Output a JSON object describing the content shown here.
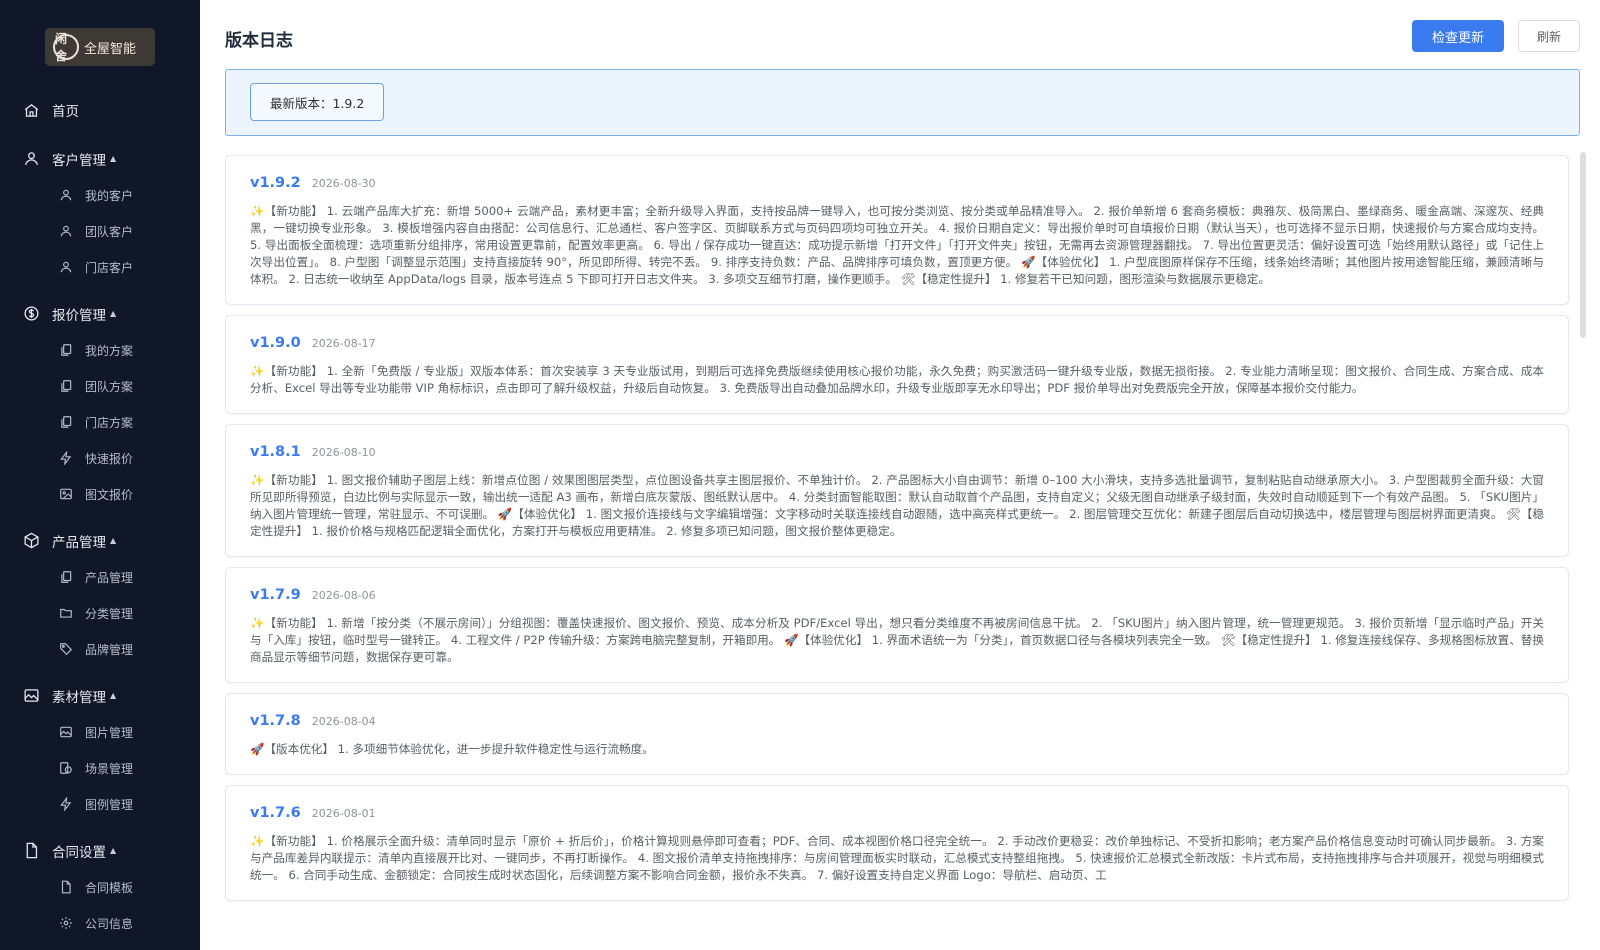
{
  "brand": {
    "logo_mark": "闲舍",
    "logo_text": "全屋智能"
  },
  "sidebar": {
    "home": "首页",
    "groups": [
      {
        "label": "客户管理",
        "items": [
          "我的客户",
          "团队客户",
          "门店客户"
        ]
      },
      {
        "label": "报价管理",
        "items": [
          "我的方案",
          "团队方案",
          "门店方案",
          "快速报价",
          "图文报价"
        ]
      },
      {
        "label": "产品管理",
        "items": [
          "产品管理",
          "分类管理",
          "品牌管理"
        ]
      },
      {
        "label": "素材管理",
        "items": [
          "图片管理",
          "场景管理",
          "图例管理"
        ]
      },
      {
        "label": "合同设置",
        "items": [
          "合同模板",
          "公司信息"
        ]
      }
    ],
    "caret": "▲"
  },
  "header": {
    "title": "版本日志",
    "check_update": "检查更新",
    "refresh": "刷新"
  },
  "current_version": "最新版本：1.9.2",
  "logs": [
    {
      "version": "v1.9.2",
      "date": "2026-08-30",
      "text": "✨【新功能】 1. 云端产品库大扩充：新增 5000+ 云端产品，素材更丰富；全新升级导入界面，支持按品牌一键导入，也可按分类浏览、按分类或单品精准导入。 2. 报价单新增 6 套商务模板：典雅灰、极简黑白、墨绿商务、暖金高端、深邃灰、经典黑，一键切换专业形象。 3. 模板增强内容自由搭配：公司信息行、汇总通栏、客户签字区、页脚联系方式与页码四项均可独立开关。 4. 报价日期自定义：导出报价单时可自填报价日期（默认当天），也可选择不显示日期，快速报价与方案合成均支持。 5. 导出面板全面梳理：选项重新分组排序，常用设置更靠前，配置效率更高。 6. 导出 / 保存成功一键直达：成功提示新增「打开文件」「打开文件夹」按钮，无需再去资源管理器翻找。 7. 导出位置更灵活：偏好设置可选「始终用默认路径」或「记住上次导出位置」。 8. 户型图「调整显示范围」支持直接旋转 90°，所见即所得、转完不丢。 9. 排序支持负数：产品、品牌排序可填负数，置顶更方便。 🚀【体验优化】 1. 户型底图原样保存不压缩，线条始终清晰；其他图片按用途智能压缩，兼顾清晰与体积。 2. 日志统一收纳至 AppData/logs 目录，版本号连点 5 下即可打开日志文件夹。 3. 多项交互细节打磨，操作更顺手。 🛠【稳定性提升】 1. 修复若干已知问题，图形渲染与数据展示更稳定。"
    },
    {
      "version": "v1.9.0",
      "date": "2026-08-17",
      "text": "✨【新功能】 1. 全新「免费版 / 专业版」双版本体系：首次安装享 3 天专业版试用，到期后可选择免费版继续使用核心报价功能，永久免费；购买激活码一键升级专业版，数据无损衔接。 2. 专业能力清晰呈现：图文报价、合同生成、方案合成、成本分析、Excel 导出等专业功能带 VIP 角标标识，点击即可了解升级权益，升级后自动恢复。 3. 免费版导出自动叠加品牌水印，升级专业版即享无水印导出；PDF 报价单导出对免费版完全开放，保障基本报价交付能力。"
    },
    {
      "version": "v1.8.1",
      "date": "2026-08-10",
      "text": "✨【新功能】 1. 图文报价辅助子图层上线：新增点位图 / 效果图图层类型，点位图设备共享主图层报价、不单独计价。 2. 产品图标大小自由调节：新增 0–100 大小滑块，支持多选批量调节，复制粘贴自动继承原大小。 3. 户型图裁剪全面升级：大窗所见即所得预览，白边比例与实际显示一致，输出统一适配 A3 画布，新增白底灰蒙版、图纸默认居中。 4. 分类封面智能取图：默认自动取首个产品图，支持自定义；父级无图自动继承子级封面，失效时自动顺延到下一个有效产品图。 5. 「SKU图片」纳入图片管理统一管理，常驻显示、不可误删。 🚀【体验优化】 1. 图文报价连接线与文字编辑增强：文字移动时关联连接线自动跟随，选中高亮样式更统一。 2. 图层管理交互优化：新建子图层后自动切换选中，楼层管理与图层树界面更清爽。 🛠【稳定性提升】 1. 报价价格与规格匹配逻辑全面优化，方案打开与模板应用更精准。 2. 修复多项已知问题，图文报价整体更稳定。"
    },
    {
      "version": "v1.7.9",
      "date": "2026-08-06",
      "text": "✨【新功能】 1. 新增「按分类（不展示房间）」分组视图：覆盖快速报价、图文报价、预览、成本分析及 PDF/Excel 导出，想只看分类维度不再被房间信息干扰。 2. 「SKU图片」纳入图片管理，统一管理更规范。 3. 报价页新增「显示临时产品」开关与「入库」按钮，临时型号一键转正。 4. 工程文件 / P2P 传输升级：方案跨电脑完整复制，开箱即用。 🚀【体验优化】 1. 界面术语统一为「分类」，首页数据口径与各模块列表完全一致。 🛠【稳定性提升】 1. 修复连接线保存、多规格图标放置、替换商品显示等细节问题，数据保存更可靠。"
    },
    {
      "version": "v1.7.8",
      "date": "2026-08-04",
      "text": "🚀【版本优化】 1. 多项细节体验优化，进一步提升软件稳定性与运行流畅度。"
    },
    {
      "version": "v1.7.6",
      "date": "2026-08-01",
      "text": "✨【新功能】 1. 价格展示全面升级：清单同时显示「原价 + 折后价」，价格计算规则悬停即可查看；PDF、合同、成本视图价格口径完全统一。 2. 手动改价更稳妥：改价单独标记、不受折扣影响；老方案产品价格信息变动时可确认同步最新。 3. 方案与产品库差异内联提示：清单内直接展开比对、一键同步，不再打断操作。 4. 图文报价清单支持拖拽排序：与房间管理面板实时联动，汇总模式支持整组拖拽。 5. 快速报价汇总模式全新改版：卡片式布局，支持拖拽排序与合并项展开，视觉与明细模式统一。 6. 合同手动生成、金额锁定：合同按生成时状态固化，后续调整方案不影响合同金额，报价永不失真。 7. 偏好设置支持自定义界面 Logo：导航栏、启动页、工"
    }
  ]
}
